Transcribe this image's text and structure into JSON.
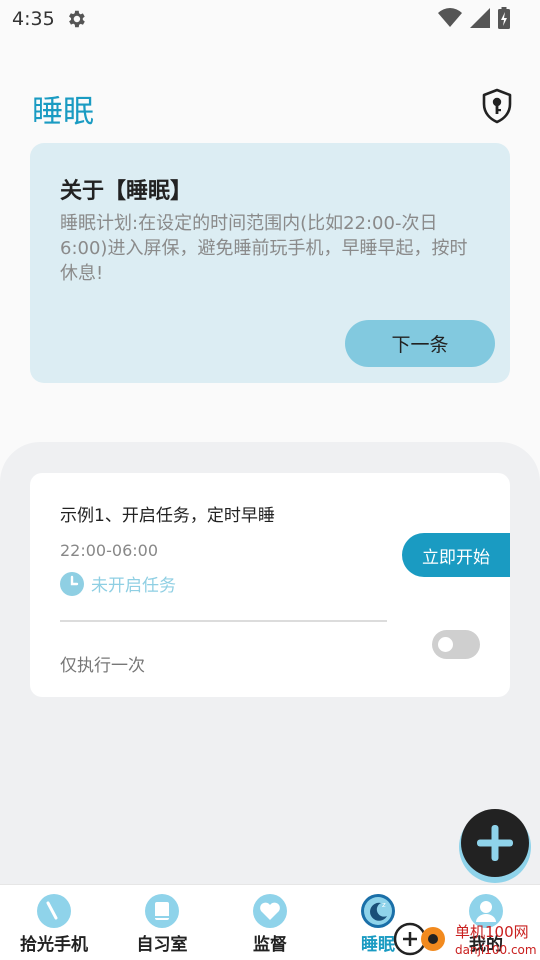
{
  "status_bar": {
    "time": "4:35"
  },
  "page": {
    "title": "睡眠"
  },
  "about": {
    "title": "关于【睡眠】",
    "description": "睡眠计划:在设定的时间范围内(比如22:00-次日6:00)进入屏保，避免睡前玩手机，早睡早起，按时休息!",
    "next_label": "下一条"
  },
  "task": {
    "title": "示例1、开启任务，定时早睡",
    "time_range": "22:00-06:00",
    "status": "未开启任务",
    "repeat": "仅执行一次",
    "start_label": "立即开始",
    "enabled": false
  },
  "nav": {
    "items": [
      {
        "label": "拾光手机",
        "icon": "phone-clock-icon"
      },
      {
        "label": "自习室",
        "icon": "book-icon"
      },
      {
        "label": "监督",
        "icon": "heart-icon"
      },
      {
        "label": "睡眠",
        "icon": "moon-icon",
        "active": true
      },
      {
        "label": "我的",
        "icon": "user-icon"
      }
    ]
  },
  "watermark": {
    "text": "单机100网",
    "url_text": "danji100.com"
  },
  "colors": {
    "accent": "#1a9bc2",
    "light_accent": "#82c9df",
    "card_bg": "#dcedf3",
    "panel_bg": "#eff0f2"
  }
}
